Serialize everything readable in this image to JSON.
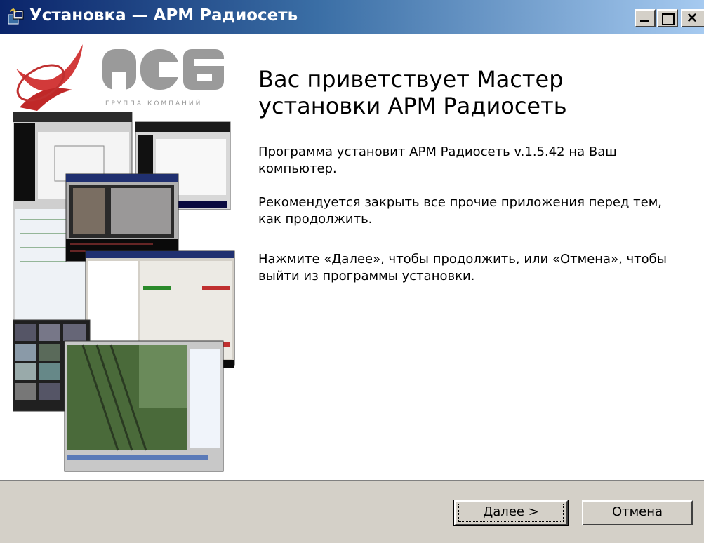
{
  "window": {
    "title": "Установка — АРМ Радиосеть",
    "colors": {
      "title_start": "#0a246a",
      "title_end": "#a6caf0",
      "face": "#d4d0c8"
    }
  },
  "sidebar": {
    "logo_text": "АСБ",
    "logo_subtitle": "ГРУППА КОМПАНИЙ"
  },
  "main": {
    "heading": "Вас приветствует Мастер установки АРМ Радиосеть",
    "paragraphs": [
      "Программа установит АРМ Радиосеть v.1.5.42 на Ваш компьютер.",
      "Рекомендуется закрыть все прочие приложения перед тем, как продолжить.",
      "Нажмите «Далее», чтобы продолжить, или «Отмена», чтобы выйти из программы установки."
    ]
  },
  "buttons": {
    "next_accel": "Д",
    "next_rest": "алее >",
    "cancel": "Отмена"
  },
  "icons": [
    "setup-icon",
    "minimize-icon",
    "maximize-icon",
    "close-icon"
  ]
}
